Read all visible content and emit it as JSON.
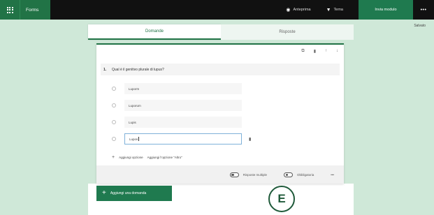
{
  "topbar": {
    "app_name": "Forms",
    "preview_label": "Anteprima",
    "theme_label": "Tema",
    "send_label": "Invia modulo",
    "more_label": "•••"
  },
  "status": {
    "saved_label": "Salvato"
  },
  "tabs": [
    {
      "label": "Domande",
      "active": true
    },
    {
      "label": "Risposte",
      "active": false
    }
  ],
  "question": {
    "number": "1.",
    "text": "Qual è il genitivo plurale di lupus?",
    "options": [
      {
        "value": "Luporm"
      },
      {
        "value": "Luporum"
      },
      {
        "value": "Lupis"
      },
      {
        "value": "Lupos"
      }
    ],
    "add_option_label": "Aggiungi opzione",
    "add_other_label": "Aggiungi l'opzione \"Altro\"",
    "multiple_answers_label": "Risposte multiple",
    "required_label": "Obbligatoria",
    "more_label": "•••"
  },
  "add_question_label": "Aggiungi una domanda",
  "badge": "E",
  "colors": {
    "brand": "#217346",
    "background": "#cfe8d8",
    "topbar": "#111111"
  },
  "icons": {
    "waffle": "waffle-icon",
    "preview": "eye-icon",
    "theme": "paint-icon",
    "copy": "copy-icon",
    "delete": "trash-icon",
    "move_up": "arrow-up-icon",
    "move_down": "arrow-down-icon"
  }
}
